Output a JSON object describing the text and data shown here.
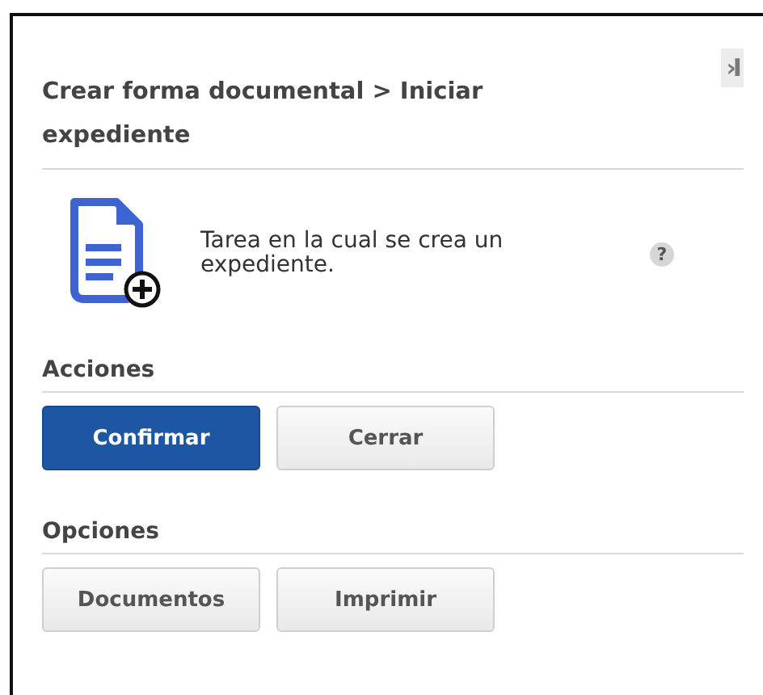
{
  "panel": {
    "title": "Crear forma documental > Iniciar expediente",
    "collapse_glyph": "›I",
    "description": "Tarea en la cual se crea un expediente.",
    "help_glyph": "?"
  },
  "sections": [
    {
      "heading": "Acciones",
      "buttons": [
        {
          "label": "Confirmar",
          "kind": "primary"
        },
        {
          "label": "Cerrar",
          "kind": "secondary"
        }
      ]
    },
    {
      "heading": "Opciones",
      "buttons": [
        {
          "label": "Documentos",
          "kind": "secondary"
        },
        {
          "label": "Imprimir",
          "kind": "secondary"
        }
      ]
    }
  ]
}
